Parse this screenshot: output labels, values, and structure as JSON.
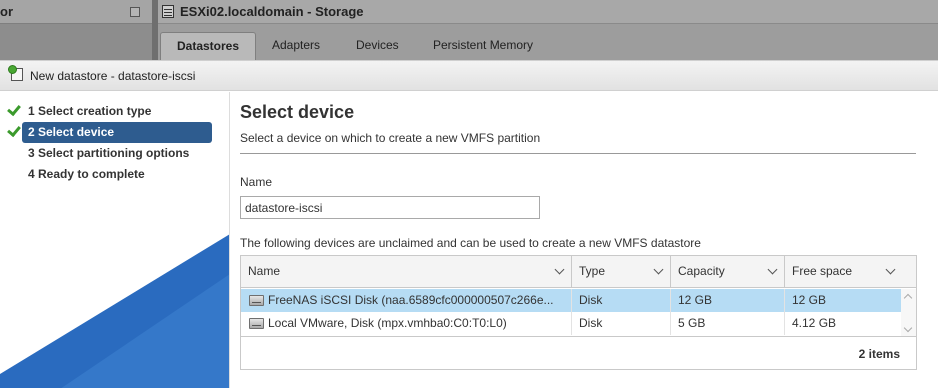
{
  "background": {
    "left_panel_title": "or",
    "window_title": "ESXi02.localdomain - Storage",
    "tabs": [
      {
        "label": "Datastores",
        "active": true
      },
      {
        "label": "Adapters",
        "active": false
      },
      {
        "label": "Devices",
        "active": false
      },
      {
        "label": "Persistent Memory",
        "active": false
      }
    ]
  },
  "dialog": {
    "title": "New datastore - datastore-iscsi",
    "steps": [
      {
        "label": "1  Select creation type",
        "completed": true,
        "active": false
      },
      {
        "label": "2  Select device",
        "completed": true,
        "active": true
      },
      {
        "label": "3  Select partitioning options",
        "completed": false,
        "active": false
      },
      {
        "label": "4  Ready to complete",
        "completed": false,
        "active": false
      }
    ],
    "heading": "Select device",
    "description": "Select a device on which to create a new VMFS partition",
    "name_label": "Name",
    "name_value": "datastore-iscsi",
    "devices_message": "The following devices are unclaimed and can be used to create a new VMFS datastore",
    "table": {
      "columns": [
        "Name",
        "Type",
        "Capacity",
        "Free space"
      ],
      "rows": [
        {
          "name": "FreeNAS iSCSI Disk (naa.6589cfc000000507c266e...",
          "type": "Disk",
          "capacity": "12 GB",
          "free": "12 GB",
          "selected": true,
          "icon": "disk-icon"
        },
        {
          "name": "Local VMware, Disk (mpx.vmhba0:C0:T0:L0)",
          "type": "Disk",
          "capacity": "5 GB",
          "free": "4.12 GB",
          "selected": false,
          "icon": "disk-icon"
        }
      ],
      "footer": "2 items"
    }
  },
  "colors": {
    "active_step": "#2e5c8f",
    "selected_row": "#b6dcf4",
    "check": "#3b9a2c",
    "accent_triangle": "#2a6bbf"
  }
}
